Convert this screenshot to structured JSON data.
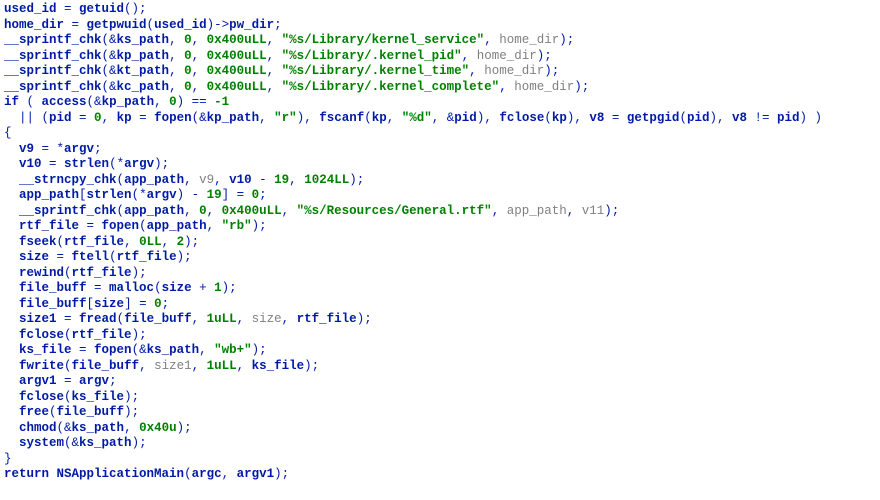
{
  "identifiers": {
    "used_id": "used_id",
    "getuid": "getuid",
    "home_dir": "home_dir",
    "getpwuid": "getpwuid",
    "pw_dir": "pw_dir",
    "sprintf_chk": "__sprintf_chk",
    "ks_path": "ks_path",
    "kp_path": "kp_path",
    "kt_path": "kt_path",
    "kc_path": "kc_path",
    "access": "access",
    "pid": "pid",
    "kp": "kp",
    "fopen": "fopen",
    "fscanf": "fscanf",
    "fclose": "fclose",
    "v8": "v8",
    "getpgid": "getpgid",
    "v9": "v9",
    "argv": "argv",
    "v10": "v10",
    "strlen": "strlen",
    "strncpy_chk": "__strncpy_chk",
    "app_path": "app_path",
    "v11": "v11",
    "rtf_file": "rtf_file",
    "fseek": "fseek",
    "size": "size",
    "ftell": "ftell",
    "rewind": "rewind",
    "file_buff": "file_buff",
    "malloc": "malloc",
    "size1": "size1",
    "fread": "fread",
    "ks_file": "ks_file",
    "fwrite": "fwrite",
    "argv1": "argv1",
    "free": "free",
    "chmod": "chmod",
    "system": "system",
    "NSApplicationMain": "NSApplicationMain",
    "argc": "argc"
  },
  "keywords": {
    "if": "if",
    "return": "return"
  },
  "numbers": {
    "zero": "0",
    "hex400": "0x400uLL",
    "neg1": "-1",
    "nineteen": "19",
    "ll1024": "1024LL",
    "zeroLL": "0LL",
    "two": "2",
    "one": "1",
    "ull1": "1uLL",
    "hex40": "0x40u"
  },
  "strings": {
    "ks": "\"%s/Library/kernel_service\"",
    "kp": "\"%s/Library/.kernel_pid\"",
    "kt": "\"%s/Library/.kernel_time\"",
    "kc": "\"%s/Library/.kernel_complete\"",
    "r": "\"r\"",
    "pd": "\"%d\"",
    "rtf": "\"%s/Resources/General.rtf\"",
    "rb": "\"rb\"",
    "wbp": "\"wb+\""
  }
}
